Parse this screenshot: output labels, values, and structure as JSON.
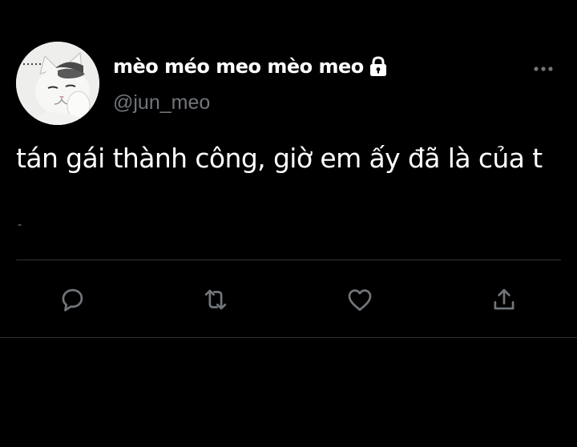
{
  "tweet": {
    "author": {
      "display_name": "mèo méo meo mèo meo",
      "handle": "@jun_meo",
      "protected_icon": "lock-icon",
      "avatar": "cat-avatar"
    },
    "text": "tán gái thành công, giờ em ấy đã là của t",
    "meta": "-",
    "more_icon": "more-horizontal-icon"
  },
  "actions": [
    {
      "name": "reply",
      "icon": "reply-bubble-icon"
    },
    {
      "name": "retweet",
      "icon": "retweet-icon"
    },
    {
      "name": "like",
      "icon": "heart-icon"
    },
    {
      "name": "share",
      "icon": "share-upload-icon"
    }
  ],
  "colors": {
    "background": "#000000",
    "primary_text": "#ffffff",
    "secondary_text": "#71767b",
    "divider": "#2f3336",
    "icon": "#71767b"
  }
}
